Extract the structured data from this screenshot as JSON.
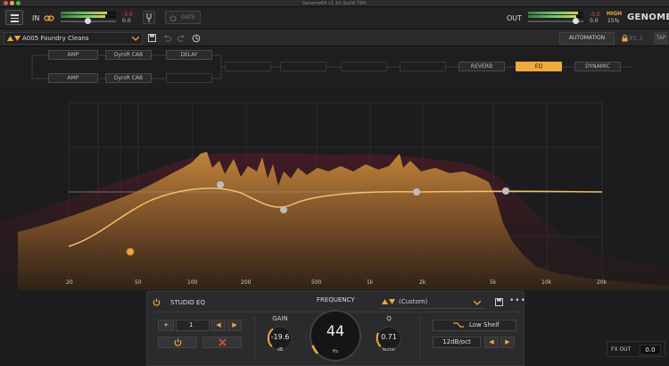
{
  "window": {
    "title": "Genome64 v1.10 (build 794)"
  },
  "topbar": {
    "in_label": "IN",
    "in_level_top": "-3.0",
    "in_level_bottom": "0.0",
    "gate_label": "GATE",
    "out_label": "OUT",
    "out_level_top": "-0.0",
    "out_level_bottom": "0.0",
    "high_label": "HIGH",
    "high_value": "15%",
    "logo": "GENOME"
  },
  "presetbar": {
    "preset_name": "A005 Foundry Cleans",
    "automation_label": "AUTOMATION",
    "bpm": "91.3",
    "tap_label": "TAP"
  },
  "chain": {
    "row1": [
      "AMP",
      "DynIR CAB",
      "DELAY"
    ],
    "row2": [
      "AMP",
      "DynIR CAB",
      ""
    ],
    "main": [
      "",
      "",
      "",
      "",
      "REVERB",
      "EQ",
      "DYNAMIC"
    ]
  },
  "eq_graph": {
    "freq_labels": [
      "20",
      "50",
      "100",
      "200",
      "500",
      "1k",
      "2k",
      "5k",
      "10k",
      "20k"
    ]
  },
  "studio_eq": {
    "title": "STUDIO EQ",
    "frequency_label": "FREQUENCY",
    "preset": "(Custom)",
    "band_number": "1",
    "gain_label": "GAIN",
    "gain_value": "-19.6",
    "gain_unit": "dB",
    "frequency_value": "44",
    "frequency_unit": "Hz",
    "q_label": "Q",
    "q_value": "0.71",
    "q_unit": "factor",
    "filter_type": "Low Shelf",
    "slope": "12dB/oct",
    "colors": {
      "accent": "#f0a93b",
      "delete": "#e04a3a"
    }
  },
  "fx_out": {
    "label": "FX OUT",
    "value": "0.0"
  }
}
